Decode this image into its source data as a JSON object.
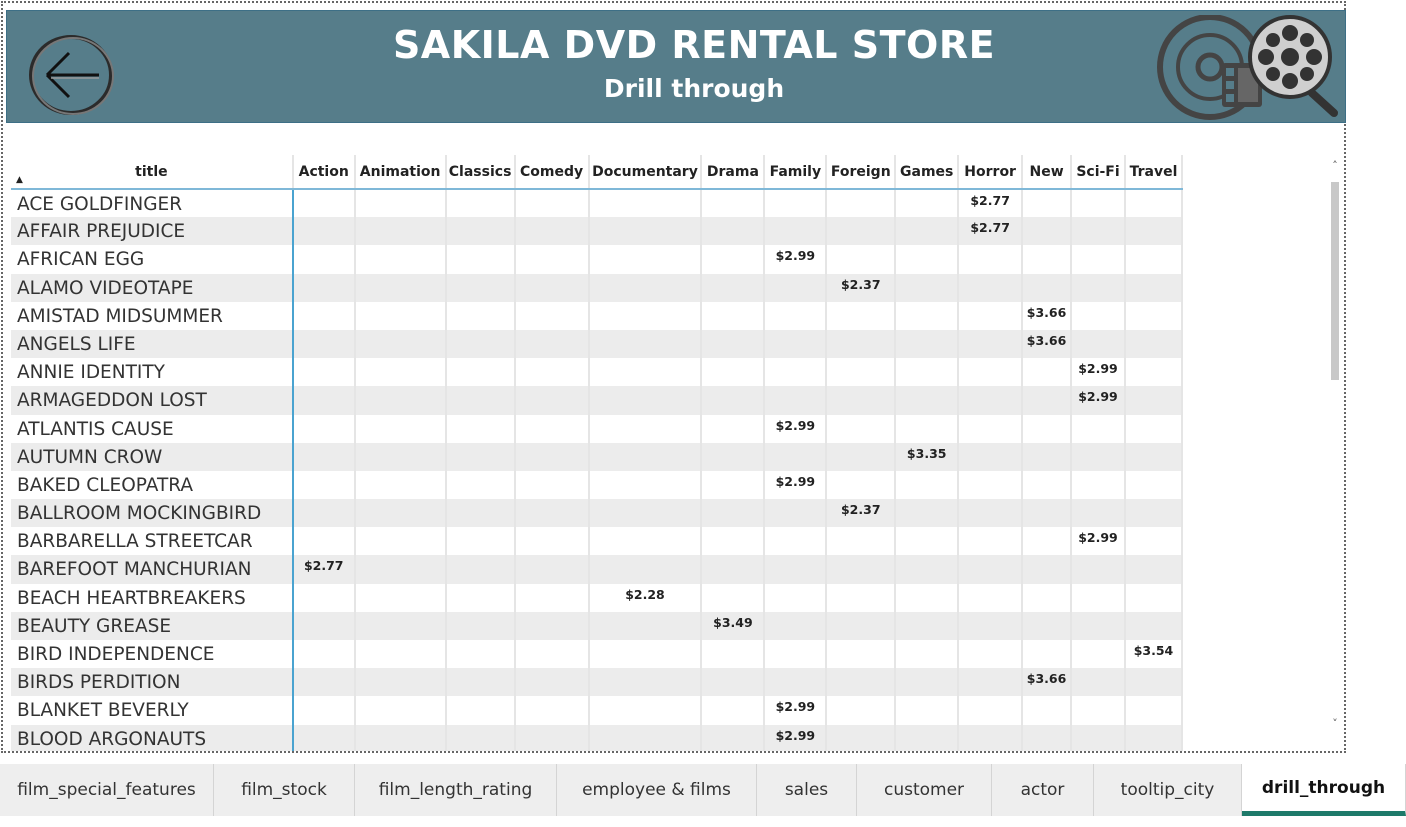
{
  "header": {
    "title": "SAKILA DVD RENTAL STORE",
    "subtitle": "Drill through"
  },
  "icons": {
    "back": "back-arrow-icon",
    "logo": "film-reel-icon"
  },
  "colors": {
    "header_bg": "#567d8a",
    "accent_tab": "#1e7a6a",
    "row_alt": "#ececec",
    "title_divider": "#4aa3d0"
  },
  "table": {
    "columns": [
      "title",
      "Action",
      "Animation",
      "Classics",
      "Comedy",
      "Documentary",
      "Drama",
      "Family",
      "Foreign",
      "Games",
      "Horror",
      "New",
      "Sci-Fi",
      "Travel"
    ],
    "rows": [
      [
        "ACE GOLDFINGER",
        "",
        "",
        "",
        "",
        "",
        "",
        "",
        "",
        "",
        "$2.77",
        "",
        "",
        ""
      ],
      [
        "AFFAIR PREJUDICE",
        "",
        "",
        "",
        "",
        "",
        "",
        "",
        "",
        "",
        "$2.77",
        "",
        "",
        ""
      ],
      [
        "AFRICAN EGG",
        "",
        "",
        "",
        "",
        "",
        "",
        "$2.99",
        "",
        "",
        "",
        "",
        "",
        ""
      ],
      [
        "ALAMO VIDEOTAPE",
        "",
        "",
        "",
        "",
        "",
        "",
        "",
        "$2.37",
        "",
        "",
        "",
        "",
        ""
      ],
      [
        "AMISTAD MIDSUMMER",
        "",
        "",
        "",
        "",
        "",
        "",
        "",
        "",
        "",
        "",
        "$3.66",
        "",
        ""
      ],
      [
        "ANGELS LIFE",
        "",
        "",
        "",
        "",
        "",
        "",
        "",
        "",
        "",
        "",
        "$3.66",
        "",
        ""
      ],
      [
        "ANNIE IDENTITY",
        "",
        "",
        "",
        "",
        "",
        "",
        "",
        "",
        "",
        "",
        "",
        "$2.99",
        ""
      ],
      [
        "ARMAGEDDON LOST",
        "",
        "",
        "",
        "",
        "",
        "",
        "",
        "",
        "",
        "",
        "",
        "$2.99",
        ""
      ],
      [
        "ATLANTIS CAUSE",
        "",
        "",
        "",
        "",
        "",
        "",
        "$2.99",
        "",
        "",
        "",
        "",
        "",
        ""
      ],
      [
        "AUTUMN CROW",
        "",
        "",
        "",
        "",
        "",
        "",
        "",
        "",
        "$3.35",
        "",
        "",
        "",
        ""
      ],
      [
        "BAKED CLEOPATRA",
        "",
        "",
        "",
        "",
        "",
        "",
        "$2.99",
        "",
        "",
        "",
        "",
        "",
        ""
      ],
      [
        "BALLROOM MOCKINGBIRD",
        "",
        "",
        "",
        "",
        "",
        "",
        "",
        "$2.37",
        "",
        "",
        "",
        "",
        ""
      ],
      [
        "BARBARELLA STREETCAR",
        "",
        "",
        "",
        "",
        "",
        "",
        "",
        "",
        "",
        "",
        "",
        "$2.99",
        ""
      ],
      [
        "BAREFOOT MANCHURIAN",
        "$2.77",
        "",
        "",
        "",
        "",
        "",
        "",
        "",
        "",
        "",
        "",
        "",
        ""
      ],
      [
        "BEACH HEARTBREAKERS",
        "",
        "",
        "",
        "",
        "$2.28",
        "",
        "",
        "",
        "",
        "",
        "",
        "",
        ""
      ],
      [
        "BEAUTY GREASE",
        "",
        "",
        "",
        "",
        "",
        "$3.49",
        "",
        "",
        "",
        "",
        "",
        "",
        ""
      ],
      [
        "BIRD INDEPENDENCE",
        "",
        "",
        "",
        "",
        "",
        "",
        "",
        "",
        "",
        "",
        "",
        "",
        "$3.54"
      ],
      [
        "BIRDS PERDITION",
        "",
        "",
        "",
        "",
        "",
        "",
        "",
        "",
        "",
        "",
        "$3.66",
        "",
        ""
      ],
      [
        "BLANKET BEVERLY",
        "",
        "",
        "",
        "",
        "",
        "",
        "$2.99",
        "",
        "",
        "",
        "",
        "",
        ""
      ],
      [
        "BLOOD ARGONAUTS",
        "",
        "",
        "",
        "",
        "",
        "",
        "$2.99",
        "",
        "",
        "",
        "",
        "",
        ""
      ]
    ]
  },
  "tabs": [
    {
      "label": "film_special_features",
      "active": false
    },
    {
      "label": "film_stock",
      "active": false
    },
    {
      "label": "film_length_rating",
      "active": false
    },
    {
      "label": "employee & films",
      "active": false
    },
    {
      "label": "sales",
      "active": false
    },
    {
      "label": "customer",
      "active": false
    },
    {
      "label": "actor",
      "active": false
    },
    {
      "label": "tooltip_city",
      "active": false
    },
    {
      "label": "drill_through",
      "active": true
    }
  ]
}
